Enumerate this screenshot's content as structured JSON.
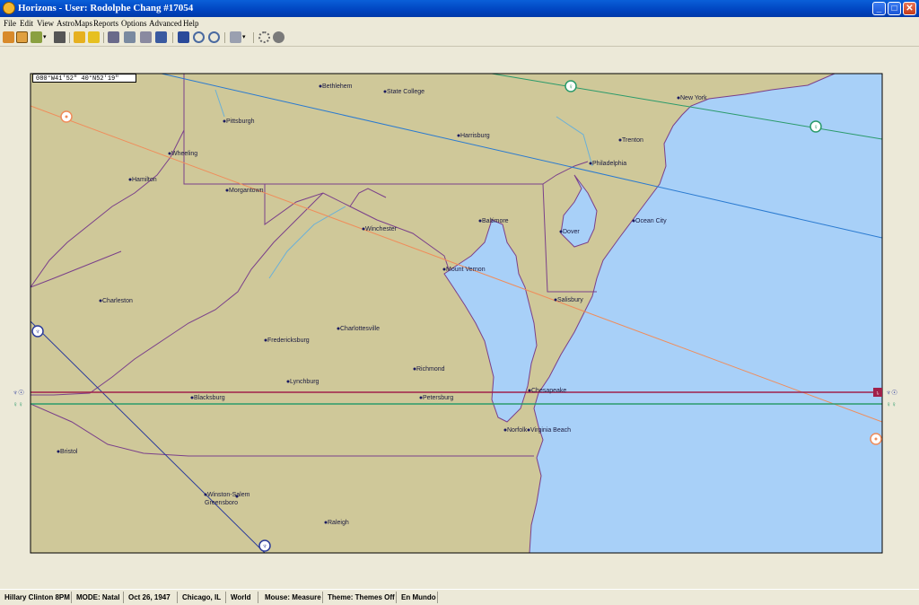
{
  "window": {
    "title": "Horizons - User: Rodolphe Chang #17054",
    "controls": {
      "minimize": "_",
      "maximize": "□",
      "close": "✕"
    }
  },
  "menu": [
    "File",
    "Edit",
    "View",
    "AstroMaps",
    "Reports",
    "Options",
    "Advanced",
    "Help"
  ],
  "toolbar": {
    "icons": [
      "new-chart-icon",
      "open-chart-icon",
      "edit-chart-icon",
      "dropdown-icon",
      "print-icon",
      "astro-map-icon",
      "relocate-icon",
      "settings-icon",
      "copy-icon",
      "lines-icon",
      "display-icon",
      "map-view-icon",
      "zoom-in-icon",
      "zoom-out-icon",
      "grid-icon",
      "dropdown-icon",
      "target-icon",
      "options-icon"
    ]
  },
  "map": {
    "coordinate_readout": "080°W41'52\"   40°N52'19\"",
    "colors": {
      "land": "#cfc899",
      "water": "#a8d0f8",
      "border": "#5a3a6a",
      "river": "#6ab0d8"
    },
    "cities": [
      {
        "name": "Bethlehem"
      },
      {
        "name": "State College"
      },
      {
        "name": "New York"
      },
      {
        "name": "Pittsburgh"
      },
      {
        "name": "Harrisburg"
      },
      {
        "name": "Trenton"
      },
      {
        "name": "Wheeling"
      },
      {
        "name": "Philadelphia"
      },
      {
        "name": "Hamilton"
      },
      {
        "name": "Morgantown"
      },
      {
        "name": "Baltimore"
      },
      {
        "name": "Ocean City"
      },
      {
        "name": "Dover"
      },
      {
        "name": "Winchester"
      },
      {
        "name": "Mount Vernon"
      },
      {
        "name": "Salisbury"
      },
      {
        "name": "Charleston"
      },
      {
        "name": "Charlottesville"
      },
      {
        "name": "Fredericksburg"
      },
      {
        "name": "Richmond"
      },
      {
        "name": "Lynchburg"
      },
      {
        "name": "Chesapeake"
      },
      {
        "name": "Blacksburg"
      },
      {
        "name": "Petersburg"
      },
      {
        "name": "Norfolk"
      },
      {
        "name": "Virginia Beach"
      },
      {
        "name": "Bristol"
      },
      {
        "name": "Winston-Salem"
      },
      {
        "name": "Greensboro"
      },
      {
        "name": "Raleigh"
      }
    ],
    "lines": [
      {
        "planet": "Sun",
        "color": "#f08c5a",
        "symbol": "☉"
      },
      {
        "planet": "Venus",
        "color": "#2a9a6a",
        "symbol": "♀"
      },
      {
        "planet": "Venus",
        "color": "#2a7ad0",
        "symbol": "♀"
      },
      {
        "planet": "Neptune",
        "color": "#2a3a9a",
        "symbol": "♆"
      },
      {
        "planet": "Saturn",
        "color": "#a0204a",
        "symbol": "♄"
      }
    ],
    "side_labels": {
      "left_top": "♆☉",
      "left_bottom": "♀♀",
      "right_top": "♆☉",
      "right_bottom": "♀♀"
    }
  },
  "status": {
    "chart": "Hillary Clinton 8PM",
    "mode": "MODE: Natal",
    "date": "Oct 26, 1947",
    "place": "Chicago, IL",
    "scope": "World",
    "mouse": "Mouse: Measure",
    "theme": "Theme: Themes Off",
    "mundo": "En Mundo"
  }
}
